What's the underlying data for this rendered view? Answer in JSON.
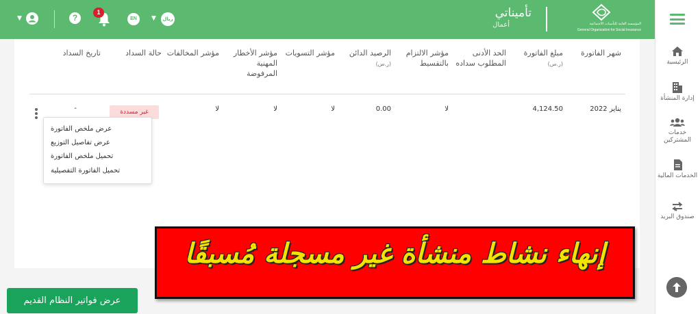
{
  "header": {
    "org_ar": "المؤسسة العامة للتأمينات الاجتماعية",
    "org_en": "General Organization for Social Insurance",
    "brand_name": "تأميناتي",
    "brand_sub": "أعمال",
    "currency_badge": "ريال",
    "language_badge": "EN",
    "notification_count": "1",
    "help_glyph": "?"
  },
  "sidebar": {
    "items": [
      {
        "label": "الرئيسية",
        "icon": "home-icon"
      },
      {
        "label": "إدارة المنشأة",
        "icon": "building-icon"
      },
      {
        "label": "خدمات المشتركين",
        "icon": "users-icon"
      },
      {
        "label": "الخدمات المالية",
        "icon": "document-icon"
      },
      {
        "label": "صندوق البريد",
        "icon": "exchange-icon"
      }
    ]
  },
  "table": {
    "headers": [
      "شهر الفاتورة",
      "مبلغ الفاتورة",
      "الحد الأدنى المطلوب سداده",
      "مؤشر الالتزام بالتقسيط",
      "الرصيد الدائن",
      "مؤشر التسويات",
      "مؤشر الأخطار المهنية المرفوضة",
      "مؤشر المخالفات",
      "حالة السداد",
      "تاريخ السداد"
    ],
    "unit_label": "(ر.س)",
    "rows": [
      {
        "month": "يناير 2022",
        "amount": "4,124.50",
        "min_due": "",
        "installment_indicator": "لا",
        "credit_balance": "0.00",
        "settlements_indicator": "لا",
        "rejected_risks_indicator": "لا",
        "violations_indicator": "لا",
        "payment_status": "غير مسددة",
        "payment_date": "-"
      }
    ]
  },
  "row_menu": {
    "items": [
      "عرض ملخص الفاتورة",
      "عرض تفاصيل التوزيع",
      "تحميل ملخص الفاتورة",
      "تحميل الفاتورة التفصيلية"
    ]
  },
  "banner": {
    "text": "إنهاء نشاط منشأة غير مسجلة مُسبقًا"
  },
  "footer": {
    "old_invoices_button": "عرض فواتير النظام القديم"
  },
  "colors": {
    "brand_green": "#5cb970",
    "button_green": "#1aa35a",
    "status_red": "#d9202a",
    "banner_red": "#ff0000",
    "banner_yellow": "#f2e400"
  }
}
